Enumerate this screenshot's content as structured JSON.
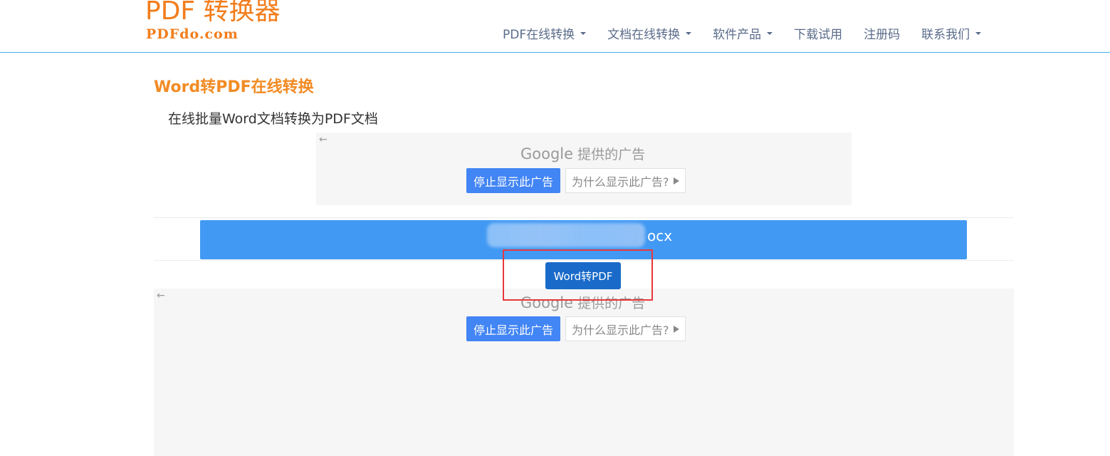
{
  "header": {
    "logo_main": "PDF 转换器",
    "logo_sub": "PDFdo.com",
    "nav": [
      {
        "label": "PDF在线转换",
        "dropdown": true
      },
      {
        "label": "文档在线转换",
        "dropdown": true
      },
      {
        "label": "软件产品",
        "dropdown": true
      },
      {
        "label": "下载试用",
        "dropdown": false
      },
      {
        "label": "注册码",
        "dropdown": false
      },
      {
        "label": "联系我们",
        "dropdown": true
      }
    ]
  },
  "main": {
    "title": "Word转PDF在线转换",
    "subtitle": "在线批量Word文档转换为PDF文档",
    "file_name_visible": "ocx",
    "convert_button": "Word转PDF"
  },
  "ads": [
    {
      "back": "←",
      "google": "Google",
      "by": "提供的广告",
      "stop": "停止显示此广告",
      "why": "为什么显示此广告?"
    },
    {
      "back": "←",
      "google": "Google",
      "by": "提供的广告",
      "stop": "停止显示此广告",
      "why": "为什么显示此广告?"
    }
  ],
  "colors": {
    "brand": "#f27d1b",
    "file_bar": "#4199f3",
    "convert_button": "#1a6bc9",
    "highlight_box": "#e8383d"
  }
}
